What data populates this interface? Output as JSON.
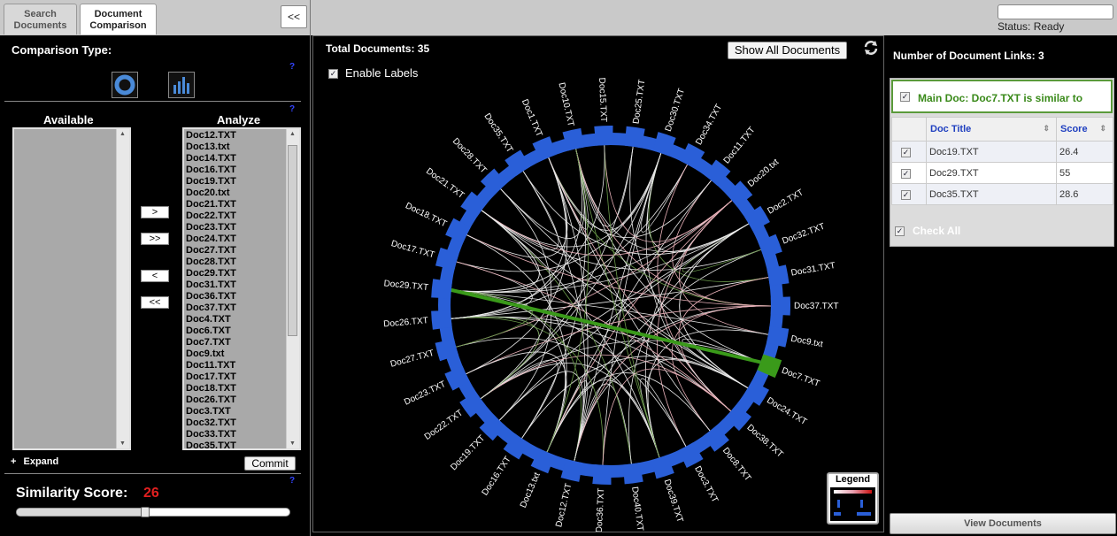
{
  "tabs": [
    {
      "label": "Search Documents"
    },
    {
      "label": "Document Comparison"
    }
  ],
  "collapse_label": "<<",
  "status": {
    "text": "Status: Ready"
  },
  "left": {
    "comparison_type_label": "Comparison Type:",
    "help": "?",
    "available_label": "Available",
    "analyze_label": "Analyze",
    "available_items": [],
    "analyze_items": [
      "Doc12.TXT",
      "Doc13.txt",
      "Doc14.TXT",
      "Doc16.TXT",
      "Doc19.TXT",
      "Doc20.txt",
      "Doc21.TXT",
      "Doc22.TXT",
      "Doc23.TXT",
      "Doc24.TXT",
      "Doc27.TXT",
      "Doc28.TXT",
      "Doc29.TXT",
      "Doc31.TXT",
      "Doc36.TXT",
      "Doc37.TXT",
      "Doc4.TXT",
      "Doc6.TXT",
      "Doc7.TXT",
      "Doc9.txt",
      "Doc11.TXT",
      "Doc17.TXT",
      "Doc18.TXT",
      "Doc26.TXT",
      "Doc3.TXT",
      "Doc32.TXT",
      "Doc33.TXT",
      "Doc35.TXT"
    ],
    "move_right": ">",
    "move_all_right": ">>",
    "move_left": "<",
    "move_all_left": "<<",
    "expand_label": "Expand",
    "expand_icon": "+",
    "commit_label": "Commit",
    "similarity_label": "Similarity Score:",
    "similarity_value": "26",
    "similarity_fraction": 0.47
  },
  "main": {
    "total_docs": "Total Documents: 35",
    "show_all_label": "Show All Documents",
    "enable_labels": "Enable Labels",
    "legend_label": "Legend",
    "ring_color": "#2a5fd8",
    "highlight_color": "#3a9a1a",
    "nodes": [
      "Doc25.TXT",
      "Doc30.TXT",
      "Doc34.TXT",
      "Doc11.TXT",
      "Doc20.txt",
      "Doc2.TXT",
      "Doc32.TXT",
      "Doc31.TXT",
      "Doc37.TXT",
      "Doc9.txt",
      "Doc7.TXT",
      "Doc24.TXT",
      "Doc38.TXT",
      "Doc8.TXT",
      "Doc3.TXT",
      "Doc39.TXT",
      "Doc40.TXT",
      "Doc36.TXT",
      "Doc12.TXT",
      "Doc13.txt",
      "Doc16.TXT",
      "Doc19.TXT",
      "Doc22.TXT",
      "Doc23.TXT",
      "Doc27.TXT",
      "Doc26.TXT",
      "Doc29.TXT",
      "Doc17.TXT",
      "Doc18.TXT",
      "Doc21.TXT",
      "Doc28.TXT",
      "Doc35.TXT",
      "Doc1.TXT",
      "Doc10.TXT",
      "Doc15.TXT"
    ]
  },
  "right": {
    "links_label": "Number of Document Links: 3",
    "main_doc": "Main Doc: Doc7.TXT is similar to",
    "col_title": "Doc Title",
    "col_score": "Score",
    "rows": [
      {
        "title": "Doc19.TXT",
        "score": "26.4"
      },
      {
        "title": "Doc29.TXT",
        "score": "55"
      },
      {
        "title": "Doc35.TXT",
        "score": "28.6"
      }
    ],
    "check_all": "Check All",
    "view_docs": "View Documents"
  }
}
